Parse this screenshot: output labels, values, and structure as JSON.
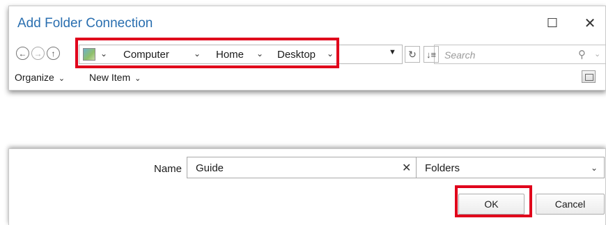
{
  "window": {
    "title": "Add Folder Connection",
    "maximize_icon": "maximize-icon",
    "close_icon": "close-icon"
  },
  "navigation": {
    "back_icon": "arrow-left-icon",
    "forward_icon": "arrow-right-icon",
    "up_icon": "arrow-up-icon",
    "breadcrumb": [
      "Computer",
      "Home",
      "Desktop"
    ],
    "refresh_icon": "refresh-icon",
    "sort_icon": "sort-icon",
    "search_placeholder": "Search",
    "search_icon": "search-icon"
  },
  "toolbar": {
    "organize_label": "Organize",
    "new_item_label": "New Item",
    "view_icon": "view-pane-icon"
  },
  "form": {
    "name_label": "Name",
    "name_value": "Guide",
    "type_value": "Folders"
  },
  "buttons": {
    "ok_label": "OK",
    "cancel_label": "Cancel"
  },
  "highlight_color": "#e0001b",
  "accent_color": "#2a6fb0"
}
